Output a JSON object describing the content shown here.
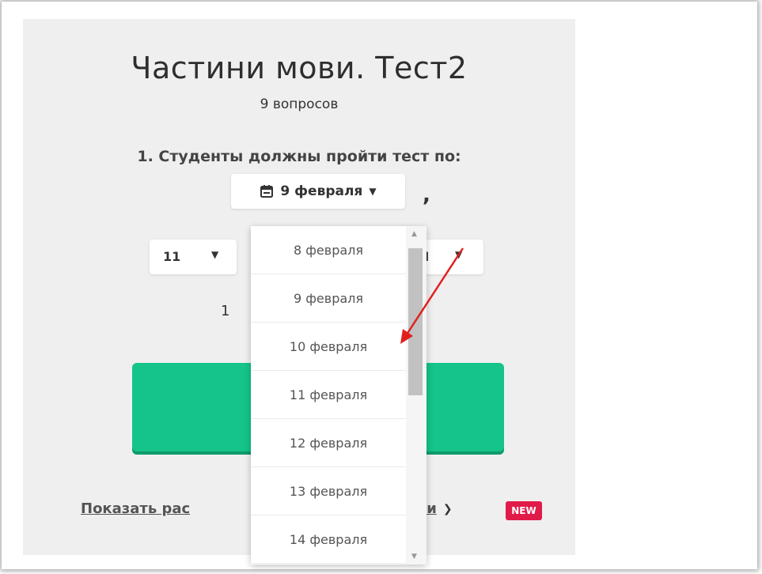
{
  "quiz": {
    "title": "Частини мови. Тест2",
    "question_count": "9 вопросов"
  },
  "form": {
    "question": "1. Студенты должны пройти тест по:",
    "date_selected": "9 февраля",
    "comma": ",",
    "hour": "11",
    "ampm": "AM",
    "partial_left": "1",
    "partial_right": "г"
  },
  "advanced": {
    "label_left": "Показать рас",
    "label_right": "ойки",
    "badge": "NEW"
  },
  "dropdown": {
    "options": [
      "8 февраля",
      "9 февраля",
      "10 февраля",
      "11 февраля",
      "12 февраля",
      "13 февраля",
      "14 февраля"
    ]
  },
  "icons": {
    "calendar": "calendar-icon",
    "caret": "caret-down-icon",
    "chevron": "chevron-down-icon"
  },
  "colors": {
    "button": "#14c48a",
    "badge": "#e01b4a",
    "annotation_arrow": "#e02020"
  }
}
